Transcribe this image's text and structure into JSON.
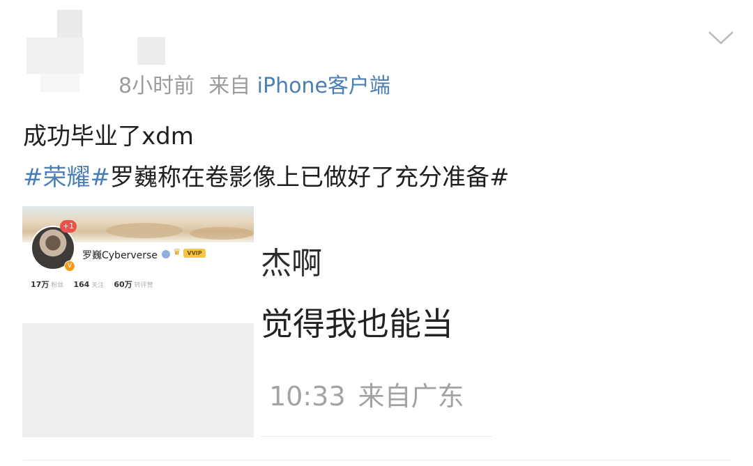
{
  "post": {
    "time": "8小时前",
    "source_prefix": "来自",
    "source": "iPhone客户端",
    "text_line1": "成功毕业了xdm",
    "tag": "#荣耀#",
    "text_line2_rest": "罗巍称在卷影像上已做好了充分准备#"
  },
  "images": {
    "left": {
      "plus_badge": "+1",
      "name": "罗巍Cyberverse",
      "vip": "VVIP",
      "stats": [
        {
          "value": "17万",
          "label": "粉丝"
        },
        {
          "value": "164",
          "label": "关注"
        },
        {
          "value": "60万",
          "label": "转评赞"
        }
      ]
    },
    "right": {
      "commenter": "杰啊",
      "comment": "觉得我也能当",
      "time": "10:33",
      "location": "来自广东"
    }
  },
  "icons": {
    "collapse": "chevron-down-icon"
  }
}
